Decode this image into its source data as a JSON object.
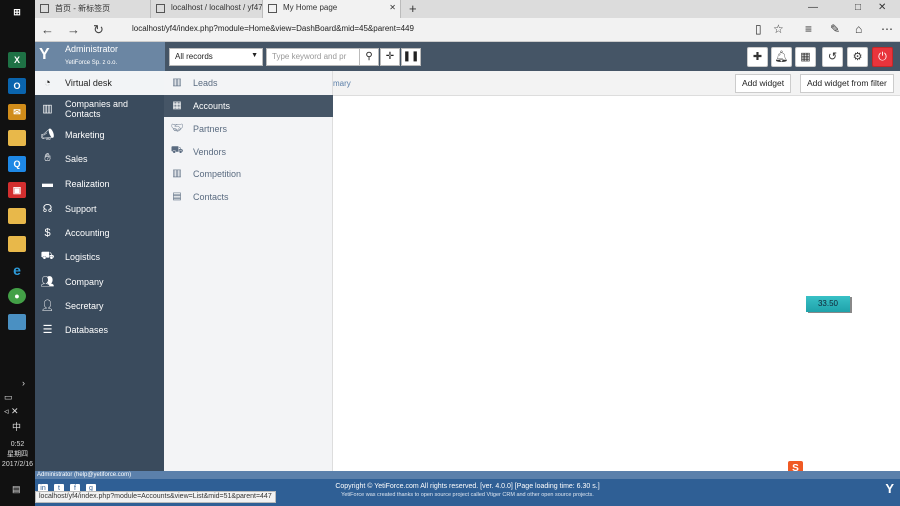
{
  "browser": {
    "tabs": [
      {
        "label": "首页 - 新标签页",
        "active": false
      },
      {
        "label": "localhost / localhost / yf47",
        "active": false
      },
      {
        "label": "My Home page",
        "active": true
      }
    ],
    "url": "localhost/yf4/index.php?module=Home&view=DashBoard&mid=45&parent=449"
  },
  "taskbar": {
    "clock_time": "0:52",
    "clock_day": "星期四",
    "clock_date": "2017/2/16",
    "lang": "中"
  },
  "app": {
    "brand": {
      "user": "Administrator",
      "org": "YetiForce Sp. z o.o."
    },
    "search": {
      "module": "All records",
      "placeholder": "Type keyword and pr"
    },
    "breadcrumb": "mary",
    "buttons": {
      "add_widget": "Add widget",
      "add_widget_filter": "Add widget from filter"
    },
    "menu": [
      {
        "label": "Virtual desk",
        "icon": "dashboard-icon"
      },
      {
        "label": "Companies and Contacts",
        "icon": "building-icon"
      },
      {
        "label": "Marketing",
        "icon": "megaphone-icon"
      },
      {
        "label": "Sales",
        "icon": "hand-coin-icon"
      },
      {
        "label": "Realization",
        "icon": "briefcase-icon"
      },
      {
        "label": "Support",
        "icon": "headset-icon"
      },
      {
        "label": "Accounting",
        "icon": "dollar-icon"
      },
      {
        "label": "Logistics",
        "icon": "logistics-icon"
      },
      {
        "label": "Company",
        "icon": "users-icon"
      },
      {
        "label": "Secretary",
        "icon": "secretary-icon"
      },
      {
        "label": "Databases",
        "icon": "database-icon"
      }
    ],
    "submenu": [
      {
        "label": "Leads",
        "icon": "leads-icon"
      },
      {
        "label": "Accounts",
        "icon": "accounts-icon"
      },
      {
        "label": "Partners",
        "icon": "handshake-icon"
      },
      {
        "label": "Vendors",
        "icon": "truck-icon"
      },
      {
        "label": "Competition",
        "icon": "competition-icon"
      },
      {
        "label": "Contacts",
        "icon": "contact-card-icon"
      }
    ],
    "widget_value": "33.50",
    "footer": {
      "user_email": "Administrator (help@yetiforce.com)",
      "copyright": "Copyright © YetiForce.com All rights reserved. [ver. 4.0.0] [Page loading time: 6.30 s.]",
      "subtext": "YetiForce was created thanks to open source project called Vtiger CRM and other open source projects.",
      "status_url": "localhost/yf4/index.php?module=Accounts&view=List&mid=51&parent=447"
    }
  },
  "colors": {
    "topbar": "#455566",
    "brand": "#6b86a3",
    "menu_bg": "#3a4b5d",
    "footer": "#2f5f95",
    "logout": "#e8343c",
    "widget": "#1fa2aa"
  }
}
